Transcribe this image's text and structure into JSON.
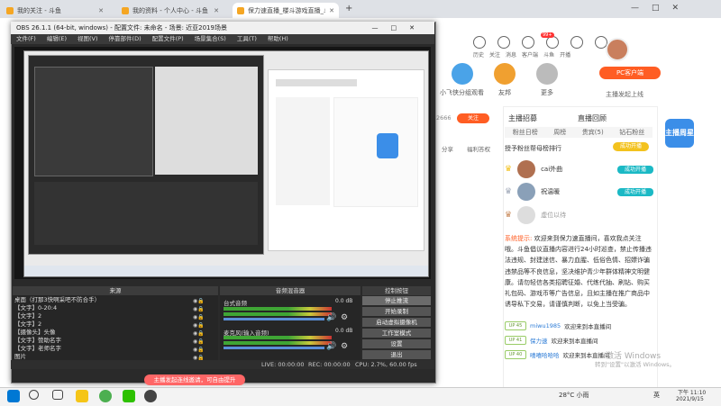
{
  "browser": {
    "tabs": [
      {
        "title": "我的关注 - 斗鱼",
        "active": false
      },
      {
        "title": "我的资料 - 个人中心 - 斗鱼",
        "active": false
      },
      {
        "title": "保力速直播_楼斗游戏直播_斗鱼",
        "active": true
      }
    ],
    "new_tab": "+"
  },
  "header_nav": {
    "items": [
      "历史",
      "关注",
      "消息",
      "客户端",
      "斗鱼",
      "开播"
    ],
    "badges": [
      "",
      "",
      "99+",
      "",
      "",
      ""
    ]
  },
  "widgets": [
    {
      "label": "小飞侠分组观看",
      "color": "#4aa3e8"
    },
    {
      "label": "友邦",
      "color": "#f0a030"
    },
    {
      "label": "更多",
      "color": "#bbb"
    }
  ],
  "pc_client": {
    "button": "PC客户端",
    "sub": "主播发起上线"
  },
  "room": {
    "follow_count": "2666",
    "follow_btn": "关注",
    "share": "分享",
    "ticket": "福利答权"
  },
  "side": {
    "tabs": [
      "主播招募",
      "直播回顾"
    ],
    "subtabs": [
      "粉丝日榜",
      "周榜",
      "贵宾(5)",
      "钻石粉丝"
    ],
    "rank_title": "授予粉丝帮母榜排行",
    "rank_rows": [
      {
        "name": "cai外曲",
        "badge": "成功开播",
        "color": "#b07050"
      },
      {
        "name": "祝温暖",
        "badge": "成功开播",
        "color": "#8aa0b8"
      },
      {
        "name": "虚位以待",
        "badge": "",
        "color": "#ddd"
      }
    ],
    "system_tag": "系统提示:",
    "system_msg": "欢迎来到保力速直播间，喜欢我点关注哦。斗鱼倡议直播内容进行24小时巡查，禁止传播违法违规、封建迷信、暴力血腥、低俗色情、招嫖诈骗违禁品等不良信息，坚决维护青少年群体精神文明健康。请勿轻信各类招聘征婚、代练代抽、刷钻、购买礼包码、游戏币等广告信息，且如主播在推广商品中诱导私下交易，请谨慎判断，以免上当受骗。",
    "chat": [
      {
        "lv": "UP 45",
        "user": "miwu1985",
        "msg": "欢迎来到本直播间"
      },
      {
        "lv": "UP 41",
        "user": "保力速",
        "msg": "欢迎来到本直播间"
      },
      {
        "lv": "UP 40",
        "user": "嘻嘻哈哈哈",
        "msg": "欢迎来到本直播间"
      }
    ],
    "activate_1": "激活 Windows",
    "activate_2": "转到\"设置\"以激活 Windows。",
    "weekly_badge": "主播周星"
  },
  "obs": {
    "title": "OBS 26.1.1 (64-bit, windows) - 配置文件: 未命名 - 场景: 近亚2019场景",
    "menu": [
      "文件(F)",
      "编辑(E)",
      "视图(V)",
      "停靠部件(D)",
      "配置文件(P)",
      "场景集合(S)",
      "工具(T)",
      "帮助(H)"
    ],
    "docks": {
      "sources": "来源",
      "mixer": "音频混音器",
      "controls": "控制按钮"
    },
    "sources": [
      "桌面（打那3快啊采吧不防合手）",
      "【文字】0-20:4",
      "【文字】2",
      "【文字】2",
      "【摄像头】头像",
      "【文字】赞助名字",
      "【文字】老师名字",
      "图片"
    ],
    "mixer": [
      {
        "name": "台式音频",
        "db": "0.0 dB"
      },
      {
        "name": "麦克风(输入音频)",
        "db": "0.0 dB"
      }
    ],
    "controls": [
      "停止推流",
      "开始录制",
      "启动虚拟摄像机",
      "工作室模式",
      "设置",
      "退出"
    ],
    "status": {
      "live": "LIVE: 00:00:00",
      "rec": "REC: 00:00:00",
      "cpu": "CPU: 2.7%, 60.00 fps"
    },
    "toast": "主播发起连线邀请，可自由提升"
  },
  "taskbar": {
    "weather": "28°C 小雨",
    "ime": "英",
    "time": "下午 11:10",
    "date": "2021/9/15"
  }
}
